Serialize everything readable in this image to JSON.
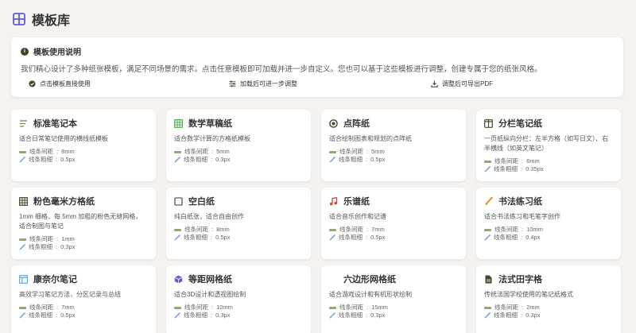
{
  "header": {
    "title": "模板库",
    "icon": "grid-icon"
  },
  "info": {
    "title": "模板使用说明",
    "description": "我们精心设计了多种纸张模板，满足不同场景的需求。点击任意模板即可加载并进一步自定义。您也可以基于这些模板进行调整，创建专属于您的纸张风格。",
    "features": [
      {
        "icon": "check-circle-icon",
        "label": "点击模板直接使用"
      },
      {
        "icon": "sliders-icon",
        "label": "加载后可进一步调整"
      },
      {
        "icon": "download-icon",
        "label": "调整后可导出PDF"
      }
    ]
  },
  "meta_labels": {
    "spacing": "线条间距",
    "thickness": "线条粗细"
  },
  "templates": [
    {
      "title": "标准笔记本",
      "icon": "lines-icon",
      "icon_color": "#8a8f4a",
      "desc": "适合日常笔记使用的横线纸模板",
      "spacing": "8mm",
      "thickness": "0.5px"
    },
    {
      "title": "数学草稿纸",
      "icon": "table-grid-icon",
      "icon_color": "#4caf50",
      "desc": "适合数学计算的方格纸模板",
      "spacing": "5mm",
      "thickness": "0.3px"
    },
    {
      "title": "点阵纸",
      "icon": "dot-circle-icon",
      "icon_color": "#3d4a2c",
      "desc": "适合绘制图表和规划的点阵纸",
      "spacing": "5mm",
      "thickness": "0.5px"
    },
    {
      "title": "分栏笔记纸",
      "icon": "columns-icon",
      "icon_color": "#3d4a2c",
      "desc": "一页纸纵向分栏：左半方格（如写日文）、右半横线（如英文笔记）",
      "spacing": "6mm",
      "thickness": "0.35px"
    },
    {
      "title": "粉色毫米方格纸",
      "icon": "table-grid-icon",
      "icon_color": "#3d4a2c",
      "desc": "1mm 细格、每 5mm 加粗的粉色无缝网格，适合制图与笔记",
      "spacing": "1mm",
      "thickness": "0.3px"
    },
    {
      "title": "空白纸",
      "icon": "square-icon",
      "icon_color": "#333333",
      "desc": "纯白纸张，适合自由创作",
      "spacing": "8mm",
      "thickness": "0.5px"
    },
    {
      "title": "乐谱纸",
      "icon": "music-note-icon",
      "icon_color": "#d9463a",
      "desc": "适合音乐创作和记谱",
      "spacing": "7mm",
      "thickness": "0.5px"
    },
    {
      "title": "书法练习纸",
      "icon": "brush-icon",
      "icon_color": "#e0902a",
      "desc": "适合书法练习和毛笔字创作",
      "spacing": "10mm",
      "thickness": "0.4px"
    },
    {
      "title": "康奈尔笔记",
      "icon": "layout-icon",
      "icon_color": "#5aa9dc",
      "desc": "高效学习笔记方法，分区记录与总结",
      "spacing": "7mm",
      "thickness": "0.5px"
    },
    {
      "title": "等距网格纸",
      "icon": "cube-icon",
      "icon_color": "#6a5acd",
      "desc": "适合3D设计和透视图绘制",
      "spacing": "10mm",
      "thickness": "0.3px"
    },
    {
      "title": "六边形网格纸",
      "icon": "hexagon-icon",
      "icon_color": "#3d4a2c",
      "desc": "适合游戏设计和有机形状绘制",
      "spacing": "15mm",
      "thickness": "0.3px"
    },
    {
      "title": "法式田字格",
      "icon": "file-doc-icon",
      "icon_color": "#3d4a2c",
      "desc": "传统法国学校使用的笔记纸格式",
      "spacing": "2mm",
      "thickness": "0.3px"
    }
  ]
}
